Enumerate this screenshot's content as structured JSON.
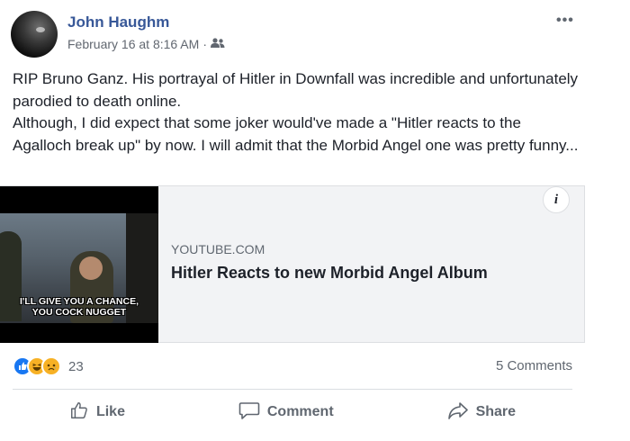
{
  "post": {
    "author": "John Haughm",
    "timestamp": "February 16 at 8:16 AM",
    "separator": "·",
    "audience_icon": "friends-icon",
    "menu_icon": "more-options-icon",
    "menu_label": "•••",
    "paragraphs": [
      "RIP Bruno Ganz. His portrayal of Hitler in Downfall was incredible and unfortunately parodied to death online.",
      "Although, I did expect that some joker would've made a \"Hitler reacts to the Agalloch break up\" by now. I will admit that the Morbid Angel one was pretty funny..."
    ]
  },
  "link_card": {
    "thumbnail_caption_line1": "I'LL GIVE YOU A CHANCE,",
    "thumbnail_caption_line2": "YOU COCK NUGGET",
    "source": "YOUTUBE.COM",
    "title": "Hitler Reacts to new Morbid Angel Album",
    "info_label": "i"
  },
  "engagement": {
    "reaction_icons": [
      "like-reaction-icon",
      "haha-reaction-icon",
      "sad-reaction-icon"
    ],
    "reaction_count": "23",
    "comments": "5 Comments"
  },
  "actions": {
    "like": "Like",
    "comment": "Comment",
    "share": "Share"
  },
  "colors": {
    "author_link": "#385898",
    "secondary_text": "#606770",
    "like_blue": "#1877f2",
    "reaction_yellow": "#f7b125"
  }
}
